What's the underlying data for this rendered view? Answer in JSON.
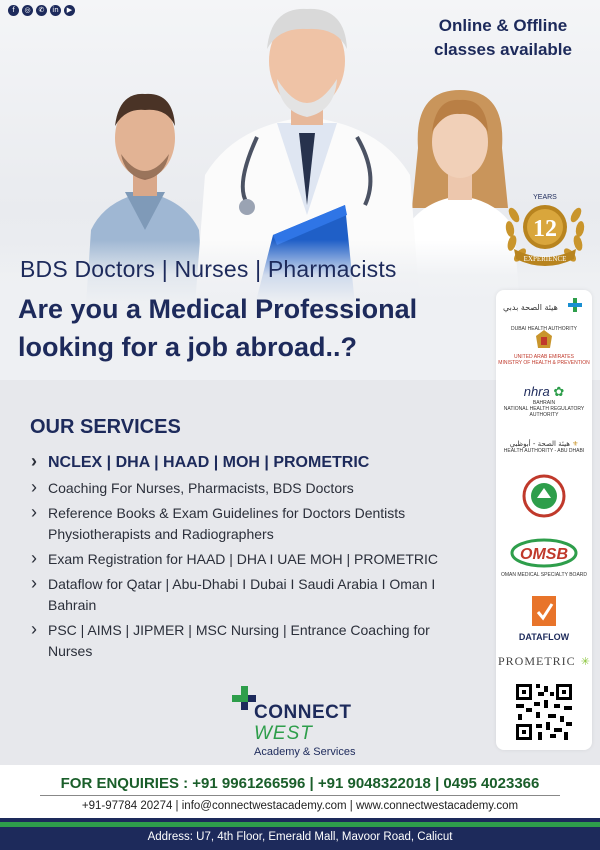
{
  "colors": {
    "navy": "#1d2a5b",
    "green": "#2e9e4b",
    "enquiry_green": "#1a5e2a",
    "gold": "#c9952c"
  },
  "social": [
    {
      "icon": "facebook-icon",
      "glyph": "f"
    },
    {
      "icon": "instagram-icon",
      "glyph": "◎"
    },
    {
      "icon": "whatsapp-icon",
      "glyph": "✆"
    },
    {
      "icon": "linkedin-icon",
      "glyph": "in"
    },
    {
      "icon": "youtube-icon",
      "glyph": "▶"
    }
  ],
  "hero": {
    "online_line1": "Online & Offline",
    "online_line2": "classes available",
    "tagline": "BDS Doctors | Nurses | Pharmacists",
    "headline_line1": "Are you a Medical Professional",
    "headline_line2": "looking for a job abroad..?"
  },
  "badge": {
    "years_label": "YEARS",
    "number": "12",
    "ribbon": "EXPERIENCE"
  },
  "services": {
    "title": "OUR SERVICES",
    "items": [
      "NCLEX | DHA | HAAD | MOH | PROMETRIC",
      "Coaching For Nurses, Pharmacists, BDS Doctors",
      "Reference Books & Exam Guidelines for Doctors Dentists Physiotherapists and Radiographers",
      "Exam Registration for HAAD | DHA I UAE MOH | PROMETRIC",
      "Dataflow for Qatar | Abu-Dhabi I Dubai I Saudi Arabia I Oman I Bahrain",
      "PSC | AIMS | JIPMER | MSC Nursing | Entrance Coaching for Nurses"
    ]
  },
  "logos": {
    "dha_arabic": "هيئة الصحة بدبي",
    "dha_english": "DUBAI HEALTH AUTHORITY",
    "uae_line1": "UNITED ARAB EMIRATES",
    "uae_line2": "MINISTRY OF HEALTH & PREVENTION",
    "nhra_name": "nhra",
    "nhra_country": "BAHRAIN",
    "nhra_english": "NATIONAL HEALTH REGULATORY AUTHORITY",
    "haad_arabic": "هيئة الصحة - أبوظبي",
    "haad_english": "HEALTH AUTHORITY - ABU DHABI",
    "omsb_name": "OMSB",
    "omsb_english": "OMAN MEDICAL SPECIALTY BOARD",
    "dataflow": "DATAFLOW",
    "prometric": "PROMETRIC"
  },
  "brand": {
    "connect": "CONNECT",
    "west": "WEST",
    "academy": "Academy & Services"
  },
  "footer": {
    "enquiry": "FOR ENQUIRIES : +91 9961266596 | +91 9048322018 | 0495 4023366",
    "contacts": "+91-97784 20274  |  info@connectwestacademy.com  |  www.connectwestacademy.com",
    "address": "Address: U7, 4th Floor, Emerald Mall, Mavoor Road, Calicut"
  }
}
